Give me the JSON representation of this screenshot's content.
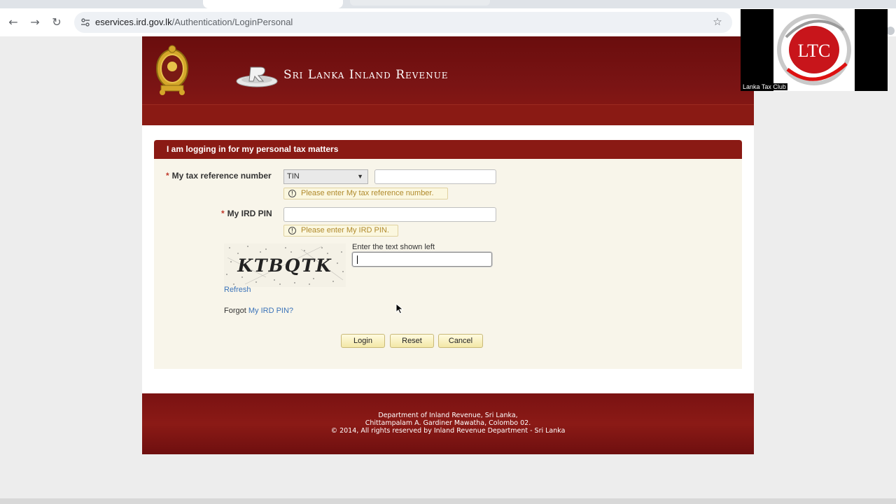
{
  "browser": {
    "url_host": "eservices.ird.gov.lk",
    "url_path": "/Authentication/LoginPersonal",
    "back_icon": "←",
    "forward_icon": "→",
    "reload_icon": "↻",
    "star_icon": "☆"
  },
  "header": {
    "brand_title": "Sri Lanka Inland Revenue",
    "emblem": "sri-lanka-emblem",
    "logo": "ird-logo"
  },
  "form": {
    "panel_title": "I am logging in for my personal tax matters",
    "tax_ref_label": "My tax reference number",
    "required_mark": "*",
    "tax_ref_type": "TIN",
    "tax_ref_value": "",
    "tax_ref_hint": "Please enter My tax reference number.",
    "pin_label": "My IRD PIN",
    "pin_value": "",
    "pin_hint": "Please enter My IRD PIN.",
    "captcha_text": "KTBQTK",
    "captcha_label": "Enter the text shown left",
    "refresh_link": "Refresh",
    "forgot_prefix": "Forgot",
    "forgot_link": "My IRD PIN?",
    "login_button": "Login",
    "reset_button": "Reset",
    "cancel_button": "Cancel"
  },
  "footer": {
    "line1": "Department of Inland Revenue, Sri Lanka,",
    "line2": "Chittampalam A. Gardiner Mawatha, Colombo 02.",
    "line3": "© 2014, All rights reserved by Inland Revenue Department - Sri Lanka"
  },
  "overlay": {
    "logo_text": "LTC",
    "caption": "Lanka Tax Club"
  },
  "colors": {
    "header_red": "#7a1414",
    "panel_bg": "#f8f5ea",
    "link_blue": "#3b73b9",
    "hint_text": "#b08a2c"
  }
}
